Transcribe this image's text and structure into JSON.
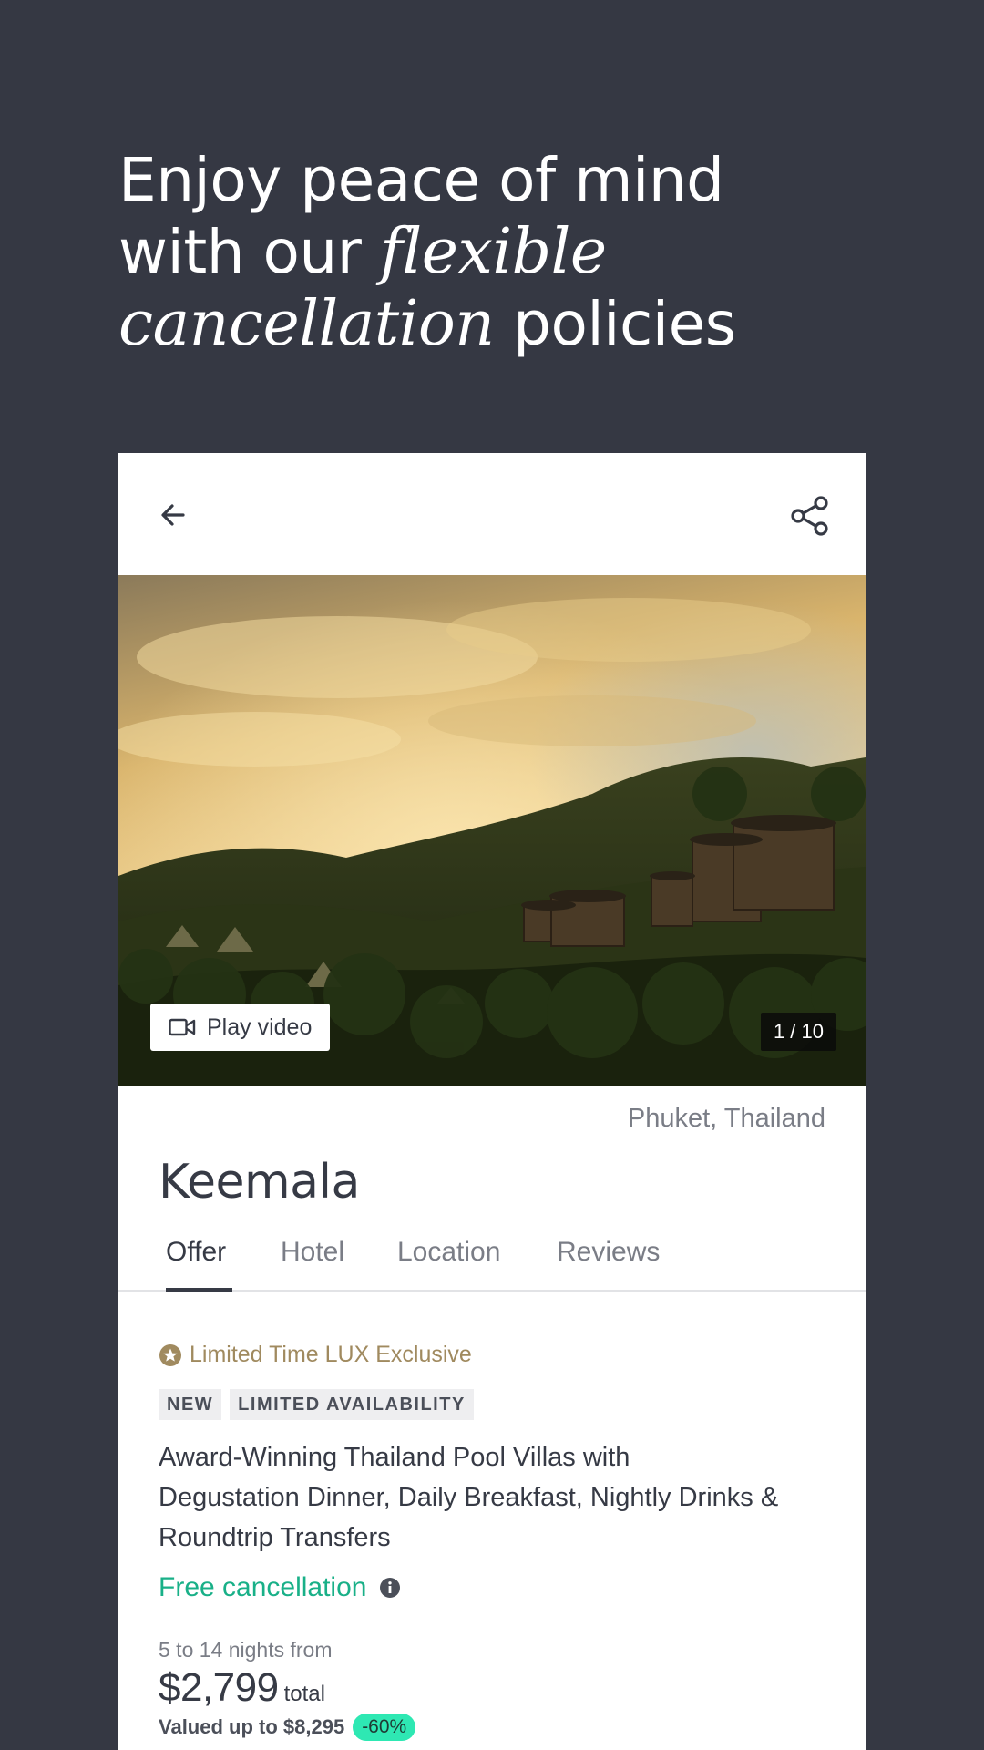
{
  "headline": {
    "line1": "Enjoy peace of mind",
    "line2_prefix": "with our ",
    "line2_italic": "flexible",
    "line3_italic": "cancellation",
    "line3_suffix": " policies"
  },
  "header": {
    "back_icon": "arrow-left-icon",
    "share_icon": "share-icon"
  },
  "gallery": {
    "play_video_label": "Play video",
    "photo_counter": "1 / 10"
  },
  "hotel": {
    "location": "Phuket, Thailand",
    "name": "Keemala"
  },
  "tabs": [
    {
      "label": "Offer",
      "active": true
    },
    {
      "label": "Hotel",
      "active": false
    },
    {
      "label": "Location",
      "active": false
    },
    {
      "label": "Reviews",
      "active": false
    }
  ],
  "offer": {
    "exclusive_label": "Limited Time LUX Exclusive",
    "badges": [
      "NEW",
      "LIMITED AVAILABILITY"
    ],
    "description_lines": [
      "Award-Winning Thailand Pool Villas with",
      "Degustation Dinner, Daily Breakfast, Nightly Drinks &",
      "Roundtrip Transfers"
    ],
    "free_cancellation": "Free cancellation",
    "nights_label": "5 to 14 nights from",
    "price": "$2,799",
    "price_suffix": "total",
    "valued": "Valued up to $8,295",
    "discount": "-60%"
  },
  "colors": {
    "background": "#353843",
    "gold_accent": "#a08a5f",
    "cancel_green": "#19b088",
    "discount_mint": "#2ee8b3"
  }
}
